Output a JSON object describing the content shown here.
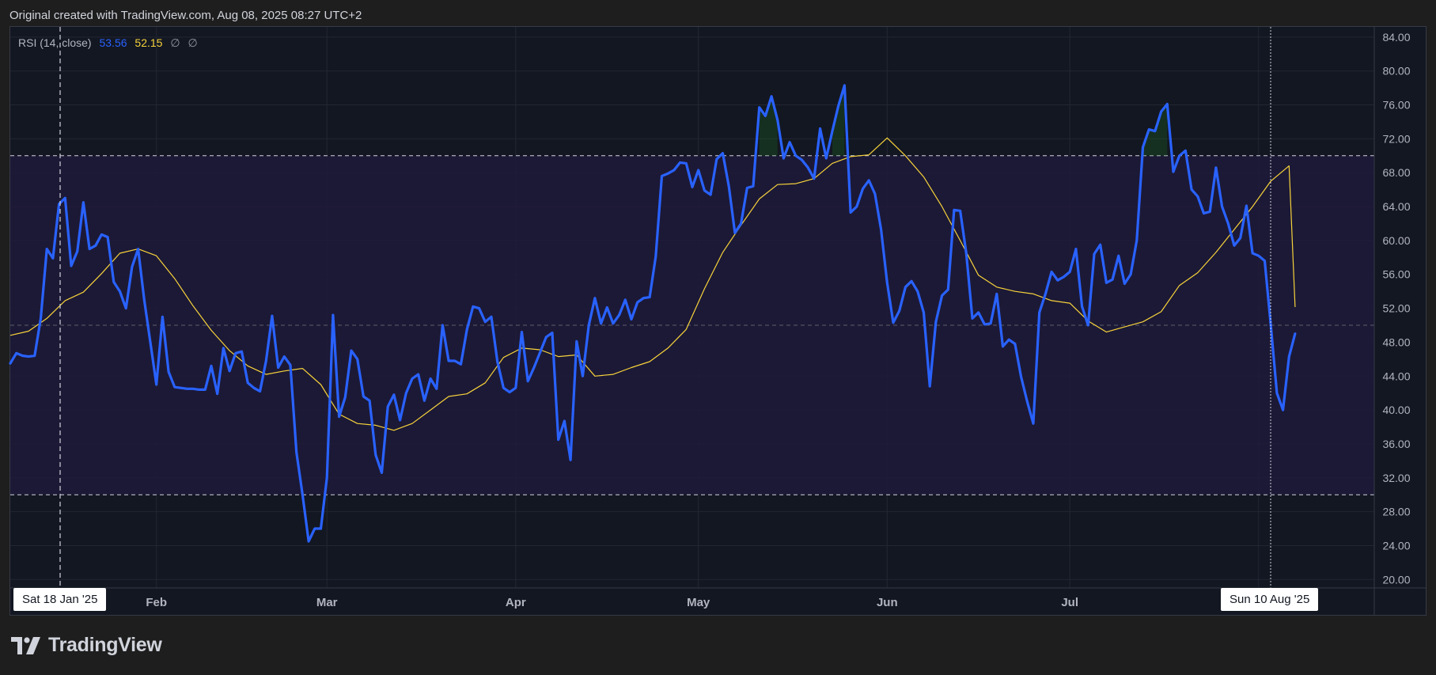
{
  "header": {
    "text": "Original created with TradingView.com, Aug 08, 2025 08:27 UTC+2"
  },
  "legend": {
    "indicator": "RSI (14, close)",
    "rsi_value": "53.56",
    "ma_value": "52.15",
    "na1": "∅",
    "na2": "∅"
  },
  "crosshair": {
    "left_date": "Sat 18 Jan '25",
    "right_date": "Sun 10 Aug '25"
  },
  "brand": {
    "name": "TradingView",
    "icon": "tradingview-logo-icon"
  },
  "colors": {
    "rsi": "#2962ff",
    "ma": "#f7d33b",
    "band": "#1e1a3a",
    "background": "#131722",
    "grid": "#232732",
    "axis_text": "#b2b5be"
  },
  "chart_data": {
    "type": "line",
    "x_axis": {
      "start": "2025-01-08",
      "end": "2025-08-20",
      "ticks": [
        {
          "date": "2025-02-01",
          "label": "Feb"
        },
        {
          "date": "2025-03-01",
          "label": "Mar"
        },
        {
          "date": "2025-04-01",
          "label": "Apr"
        },
        {
          "date": "2025-05-01",
          "label": "May"
        },
        {
          "date": "2025-06-01",
          "label": "Jun"
        },
        {
          "date": "2025-07-01",
          "label": "Jul"
        },
        {
          "date": "2025-08-01",
          "label": "Aug"
        }
      ]
    },
    "y_axis": {
      "ylim": [
        19.0,
        85.2
      ],
      "ticks": [
        "84.00",
        "80.00",
        "76.00",
        "72.00",
        "68.00",
        "64.00",
        "60.00",
        "56.00",
        "52.00",
        "48.00",
        "44.00",
        "40.00",
        "36.00",
        "32.00",
        "28.00",
        "24.00",
        "20.00"
      ]
    },
    "levels": {
      "upper": 70,
      "middle": 50,
      "lower": 30
    },
    "series": [
      {
        "name": "RSI (14, close)",
        "dates": [
          "2025-01-08",
          "2025-01-09",
          "2025-01-10",
          "2025-01-11",
          "2025-01-12",
          "2025-01-13",
          "2025-01-14",
          "2025-01-15",
          "2025-01-16",
          "2025-01-17",
          "2025-01-18",
          "2025-01-19",
          "2025-01-20",
          "2025-01-21",
          "2025-01-22",
          "2025-01-23",
          "2025-01-24",
          "2025-01-25",
          "2025-01-26",
          "2025-01-27",
          "2025-01-28",
          "2025-01-29",
          "2025-01-30",
          "2025-01-31",
          "2025-02-01",
          "2025-02-02",
          "2025-02-03",
          "2025-02-04",
          "2025-02-05",
          "2025-02-06",
          "2025-02-07",
          "2025-02-08",
          "2025-02-09",
          "2025-02-10",
          "2025-02-11",
          "2025-02-12",
          "2025-02-13",
          "2025-02-14",
          "2025-02-15",
          "2025-02-16",
          "2025-02-17",
          "2025-02-18",
          "2025-02-19",
          "2025-02-20",
          "2025-02-21",
          "2025-02-22",
          "2025-02-23",
          "2025-02-24",
          "2025-02-25",
          "2025-02-26",
          "2025-02-27",
          "2025-02-28",
          "2025-03-01",
          "2025-03-02",
          "2025-03-03",
          "2025-03-04",
          "2025-03-05",
          "2025-03-06",
          "2025-03-07",
          "2025-03-08",
          "2025-03-09",
          "2025-03-10",
          "2025-03-11",
          "2025-03-12",
          "2025-03-13",
          "2025-03-14",
          "2025-03-15",
          "2025-03-16",
          "2025-03-17",
          "2025-03-18",
          "2025-03-19",
          "2025-03-20",
          "2025-03-21",
          "2025-03-22",
          "2025-03-23",
          "2025-03-24",
          "2025-03-25",
          "2025-03-26",
          "2025-03-27",
          "2025-03-28",
          "2025-03-29",
          "2025-03-30",
          "2025-03-31",
          "2025-04-01",
          "2025-04-02",
          "2025-04-03",
          "2025-04-04",
          "2025-04-05",
          "2025-04-06",
          "2025-04-07",
          "2025-04-08",
          "2025-04-09",
          "2025-04-10",
          "2025-04-11",
          "2025-04-12",
          "2025-04-13",
          "2025-04-14",
          "2025-04-15",
          "2025-04-16",
          "2025-04-17",
          "2025-04-18",
          "2025-04-19",
          "2025-04-20",
          "2025-04-21",
          "2025-04-22",
          "2025-04-23",
          "2025-04-24",
          "2025-04-25",
          "2025-04-26",
          "2025-04-27",
          "2025-04-28",
          "2025-04-29",
          "2025-04-30",
          "2025-05-01",
          "2025-05-02",
          "2025-05-03",
          "2025-05-04",
          "2025-05-05",
          "2025-05-06",
          "2025-05-07",
          "2025-05-08",
          "2025-05-09",
          "2025-05-10",
          "2025-05-11",
          "2025-05-12",
          "2025-05-13",
          "2025-05-14",
          "2025-05-15",
          "2025-05-16",
          "2025-05-17",
          "2025-05-18",
          "2025-05-19",
          "2025-05-20",
          "2025-05-21",
          "2025-05-22",
          "2025-05-23",
          "2025-05-24",
          "2025-05-25",
          "2025-05-26",
          "2025-05-27",
          "2025-05-28",
          "2025-05-29",
          "2025-05-30",
          "2025-05-31",
          "2025-06-01",
          "2025-06-02",
          "2025-06-03",
          "2025-06-04",
          "2025-06-05",
          "2025-06-06",
          "2025-06-07",
          "2025-06-08",
          "2025-06-09",
          "2025-06-10",
          "2025-06-11",
          "2025-06-12",
          "2025-06-13",
          "2025-06-14",
          "2025-06-15",
          "2025-06-16",
          "2025-06-17",
          "2025-06-18",
          "2025-06-19",
          "2025-06-20",
          "2025-06-21",
          "2025-06-22",
          "2025-06-23",
          "2025-06-24",
          "2025-06-25",
          "2025-06-26",
          "2025-06-27",
          "2025-06-28",
          "2025-06-29",
          "2025-06-30",
          "2025-07-01",
          "2025-07-02",
          "2025-07-03",
          "2025-07-04",
          "2025-07-05",
          "2025-07-06",
          "2025-07-07",
          "2025-07-08",
          "2025-07-09",
          "2025-07-10",
          "2025-07-11",
          "2025-07-12",
          "2025-07-13",
          "2025-07-14",
          "2025-07-15",
          "2025-07-16",
          "2025-07-17",
          "2025-07-18",
          "2025-07-19",
          "2025-07-20",
          "2025-07-21",
          "2025-07-22",
          "2025-07-23",
          "2025-07-24",
          "2025-07-25",
          "2025-07-26",
          "2025-07-27",
          "2025-07-28",
          "2025-07-29",
          "2025-07-30",
          "2025-07-31",
          "2025-08-01",
          "2025-08-02",
          "2025-08-03",
          "2025-08-04",
          "2025-08-05",
          "2025-08-06",
          "2025-08-07"
        ],
        "values": [
          45.5,
          46.7,
          46.4,
          46.3,
          46.4,
          50.8,
          59.0,
          57.9,
          64.3,
          65.0,
          57.0,
          58.7,
          64.5,
          59.0,
          59.4,
          60.7,
          60.4,
          55.1,
          54.0,
          52.0,
          56.9,
          59.0,
          53.0,
          48.0,
          43.0,
          51.0,
          44.5,
          42.7,
          42.6,
          42.5,
          42.5,
          42.4,
          42.4,
          45.2,
          41.9,
          47.3,
          44.6,
          46.7,
          46.9,
          43.2,
          42.6,
          42.2,
          45.8,
          51.1,
          45.0,
          46.3,
          45.3,
          35.0,
          30.0,
          24.5,
          26.0,
          26.0,
          32.0,
          51.2,
          39.2,
          41.5,
          47.0,
          46.0,
          41.6,
          41.1,
          34.7,
          32.6,
          40.4,
          41.8,
          38.8,
          42.0,
          43.7,
          44.2,
          41.1,
          43.7,
          42.5,
          50.0,
          45.8,
          45.8,
          45.4,
          49.5,
          52.2,
          52.0,
          50.4,
          51.0,
          45.7,
          42.6,
          42.1,
          42.6,
          49.2,
          43.4,
          45.0,
          46.8,
          48.6,
          49.1,
          36.5,
          38.7,
          34.1,
          48.1,
          44.0,
          50.0,
          53.2,
          50.2,
          52.1,
          50.2,
          51.2,
          53.0,
          50.7,
          52.7,
          53.2,
          53.3,
          58.1,
          67.6,
          67.9,
          68.3,
          69.2,
          69.1,
          66.3,
          68.3,
          65.9,
          65.4,
          69.6,
          70.3,
          66.4,
          60.9,
          62.0,
          66.2,
          66.4,
          75.7,
          74.7,
          77.0,
          74.2,
          69.7,
          71.6,
          70.0,
          69.5,
          68.6,
          67.3,
          73.2,
          69.7,
          72.9,
          75.9,
          78.3,
          63.3,
          64.0,
          66.1,
          67.1,
          65.5,
          61.3,
          55.0,
          50.3,
          51.7,
          54.5,
          55.2,
          54.0,
          51.5,
          42.8,
          50.4,
          53.5,
          54.2,
          63.6,
          63.5,
          58.5,
          50.8,
          51.5,
          50.1,
          50.2,
          53.7,
          47.5,
          48.3,
          47.8,
          43.9,
          41.0,
          38.4,
          51.5,
          53.7,
          56.3,
          55.3,
          55.7,
          56.3,
          59.0,
          52.2,
          50.0,
          58.4,
          59.5,
          55.0,
          55.4,
          58.2,
          54.9,
          56.0,
          60.0,
          71.0,
          73.1,
          72.9,
          75.2,
          76.1,
          68.1,
          70.0,
          70.6,
          66.0,
          65.2,
          63.2,
          63.4,
          68.6,
          64.0,
          62.0,
          59.4,
          60.3,
          64.1,
          58.5,
          58.2,
          57.6,
          50.0,
          42.0,
          40.0,
          46.3,
          49.0,
          46.0,
          49.3,
          56.7,
          53.6
        ]
      },
      {
        "name": "RSI-based MA",
        "dates": [
          "2025-01-08",
          "2025-01-11",
          "2025-01-14",
          "2025-01-17",
          "2025-01-20",
          "2025-01-23",
          "2025-01-26",
          "2025-01-29",
          "2025-02-01",
          "2025-02-04",
          "2025-02-07",
          "2025-02-10",
          "2025-02-13",
          "2025-02-16",
          "2025-02-19",
          "2025-02-22",
          "2025-02-25",
          "2025-02-28",
          "2025-03-03",
          "2025-03-06",
          "2025-03-09",
          "2025-03-12",
          "2025-03-15",
          "2025-03-18",
          "2025-03-21",
          "2025-03-24",
          "2025-03-27",
          "2025-03-30",
          "2025-04-02",
          "2025-04-05",
          "2025-04-08",
          "2025-04-11",
          "2025-04-14",
          "2025-04-17",
          "2025-04-20",
          "2025-04-23",
          "2025-04-26",
          "2025-04-29",
          "2025-05-02",
          "2025-05-05",
          "2025-05-08",
          "2025-05-11",
          "2025-05-14",
          "2025-05-17",
          "2025-05-20",
          "2025-05-23",
          "2025-05-26",
          "2025-05-29",
          "2025-06-01",
          "2025-06-04",
          "2025-06-07",
          "2025-06-10",
          "2025-06-13",
          "2025-06-16",
          "2025-06-19",
          "2025-06-22",
          "2025-06-25",
          "2025-06-28",
          "2025-07-01",
          "2025-07-04",
          "2025-07-07",
          "2025-07-10",
          "2025-07-13",
          "2025-07-16",
          "2025-07-19",
          "2025-07-22",
          "2025-07-25",
          "2025-07-28",
          "2025-07-31",
          "2025-08-03",
          "2025-08-06",
          "2025-08-07"
        ],
        "values": [
          48.8,
          49.3,
          50.8,
          52.9,
          53.9,
          56.1,
          58.5,
          59.0,
          58.2,
          55.5,
          52.3,
          49.4,
          47.0,
          45.2,
          44.2,
          44.6,
          44.9,
          43.0,
          39.5,
          38.4,
          38.2,
          37.6,
          38.4,
          40.0,
          41.6,
          41.9,
          43.2,
          46.2,
          47.3,
          47.1,
          46.3,
          46.5,
          44.0,
          44.2,
          45.0,
          45.7,
          47.3,
          49.5,
          54.3,
          58.6,
          61.8,
          64.9,
          66.6,
          66.7,
          67.3,
          69.1,
          69.9,
          70.1,
          72.1,
          70.0,
          67.5,
          64.0,
          60.0,
          55.9,
          54.5,
          54.0,
          53.7,
          52.9,
          52.6,
          50.5,
          49.2,
          49.8,
          50.4,
          51.6,
          54.7,
          56.2,
          58.6,
          61.3,
          64.0,
          67.0,
          68.8,
          52.15
        ]
      }
    ]
  }
}
